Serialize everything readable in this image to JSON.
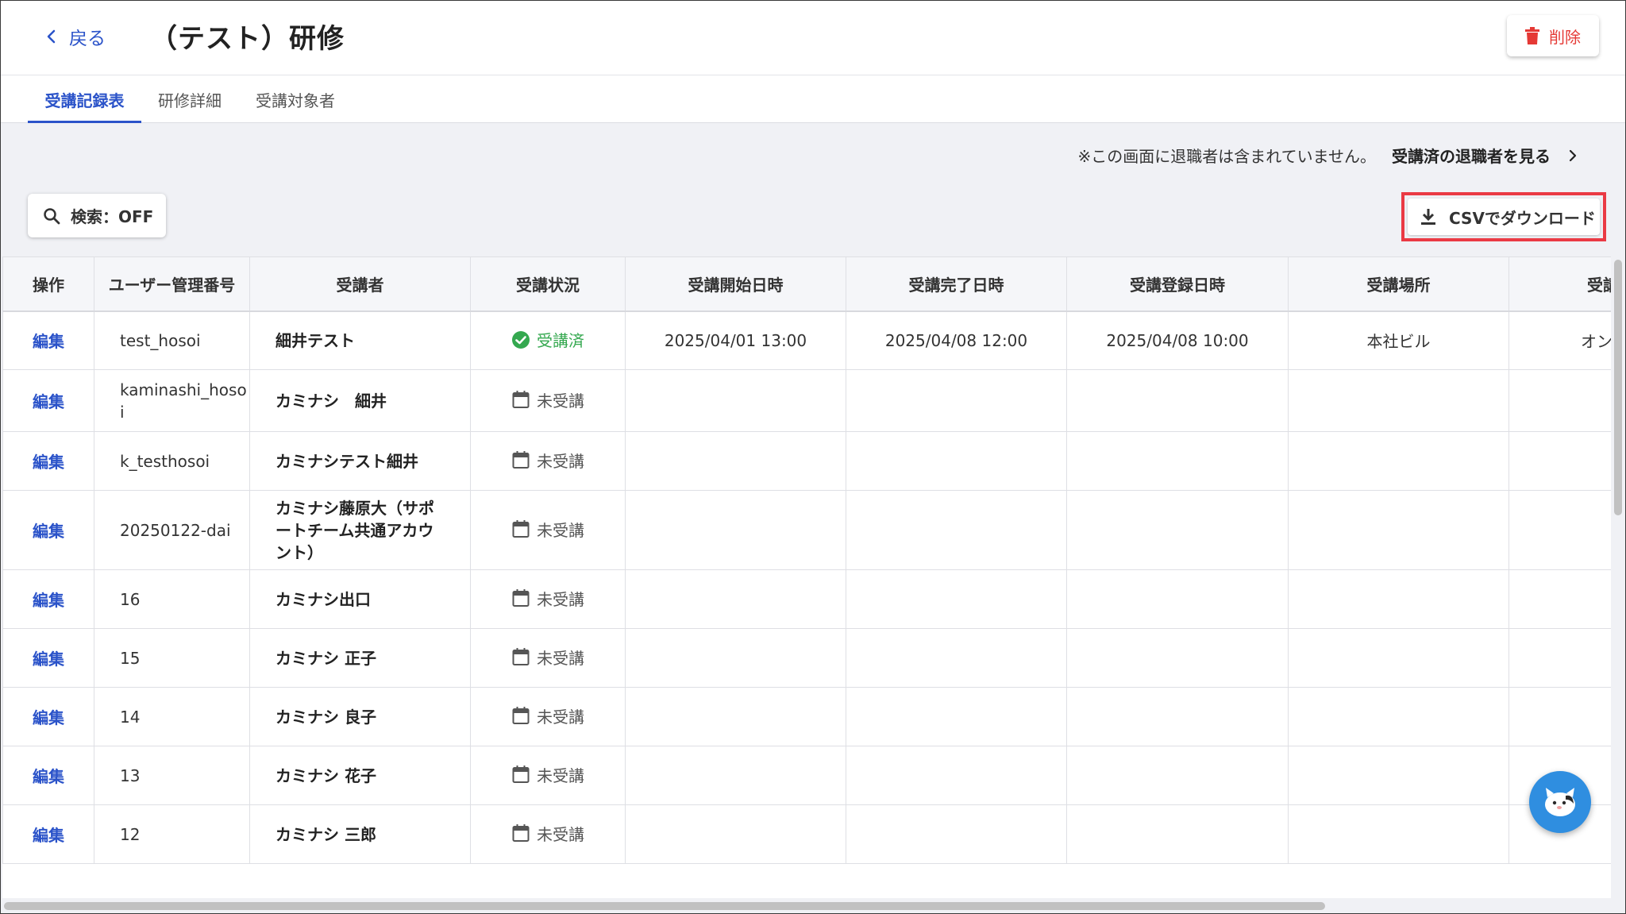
{
  "header": {
    "back_label": "戻る",
    "title": "（テスト）研修",
    "delete_label": "削除"
  },
  "tabs": [
    {
      "label": "受講記録表",
      "active": true
    },
    {
      "label": "研修詳細",
      "active": false
    },
    {
      "label": "受講対象者",
      "active": false
    }
  ],
  "notice": {
    "text": "※この画面に退職者は含まれていません。",
    "link_label": "受講済の退職者を見る"
  },
  "toolbar": {
    "search_label": "検索：OFF",
    "csv_label": "CSVでダウンロード"
  },
  "table": {
    "columns": [
      "操作",
      "ユーザー管理番号",
      "受講者",
      "受講状況",
      "受講開始日時",
      "受講完了日時",
      "受講登録日時",
      "受講場所",
      "受講"
    ],
    "edit_label": "編集",
    "rows": [
      {
        "uid": "test_hosoi",
        "name": "細井テスト",
        "status": "受講済",
        "start": "2025/04/01 13:00",
        "end": "2025/04/08 12:00",
        "registered": "2025/04/08 10:00",
        "place": "本社ビル",
        "extra": "オン"
      },
      {
        "uid": "kaminashi_hosoi",
        "name": "カミナシ　細井",
        "status": "未受講",
        "start": "",
        "end": "",
        "registered": "",
        "place": "",
        "extra": ""
      },
      {
        "uid": "k_testhosoi",
        "name": "カミナシテスト細井",
        "status": "未受講",
        "start": "",
        "end": "",
        "registered": "",
        "place": "",
        "extra": ""
      },
      {
        "uid": "20250122-dai",
        "name": "カミナシ藤原大（サポートチーム共通アカウント）",
        "status": "未受講",
        "start": "",
        "end": "",
        "registered": "",
        "place": "",
        "extra": ""
      },
      {
        "uid": "16",
        "name": "カミナシ出口",
        "status": "未受講",
        "start": "",
        "end": "",
        "registered": "",
        "place": "",
        "extra": ""
      },
      {
        "uid": "15",
        "name": "カミナシ 正子",
        "status": "未受講",
        "start": "",
        "end": "",
        "registered": "",
        "place": "",
        "extra": ""
      },
      {
        "uid": "14",
        "name": "カミナシ 良子",
        "status": "未受講",
        "start": "",
        "end": "",
        "registered": "",
        "place": "",
        "extra": ""
      },
      {
        "uid": "13",
        "name": "カミナシ 花子",
        "status": "未受講",
        "start": "",
        "end": "",
        "registered": "",
        "place": "",
        "extra": ""
      },
      {
        "uid": "12",
        "name": "カミナシ 三郎",
        "status": "未受講",
        "start": "",
        "end": "",
        "registered": "",
        "place": "",
        "extra": ""
      }
    ]
  },
  "colors": {
    "accent": "#2b53c9",
    "danger": "#e53935",
    "done": "#34a84f",
    "highlight": "#ea3a44"
  },
  "icons": {
    "back": "chevron-left-icon",
    "delete": "trash-icon",
    "notice_link": "chevron-right-icon",
    "search": "search-icon",
    "csv": "download-icon",
    "done_status": "check-circle-icon",
    "pending_status": "calendar-icon",
    "chat": "chat-mascot-icon"
  }
}
